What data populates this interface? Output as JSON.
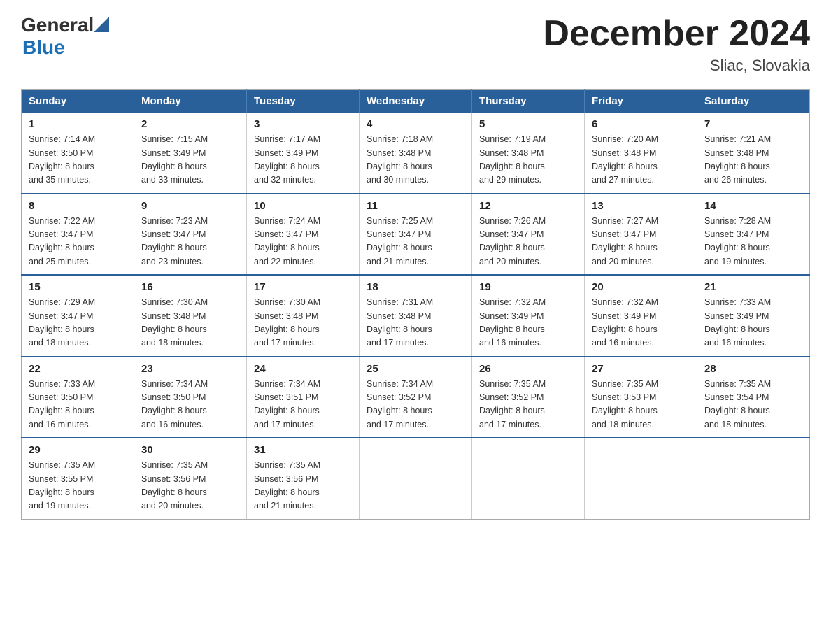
{
  "header": {
    "logo_general": "General",
    "logo_blue": "Blue",
    "title": "December 2024",
    "location": "Sliac, Slovakia"
  },
  "days_of_week": [
    "Sunday",
    "Monday",
    "Tuesday",
    "Wednesday",
    "Thursday",
    "Friday",
    "Saturday"
  ],
  "weeks": [
    [
      {
        "day": "1",
        "sunrise": "7:14 AM",
        "sunset": "3:50 PM",
        "daylight": "8 hours and 35 minutes."
      },
      {
        "day": "2",
        "sunrise": "7:15 AM",
        "sunset": "3:49 PM",
        "daylight": "8 hours and 33 minutes."
      },
      {
        "day": "3",
        "sunrise": "7:17 AM",
        "sunset": "3:49 PM",
        "daylight": "8 hours and 32 minutes."
      },
      {
        "day": "4",
        "sunrise": "7:18 AM",
        "sunset": "3:48 PM",
        "daylight": "8 hours and 30 minutes."
      },
      {
        "day": "5",
        "sunrise": "7:19 AM",
        "sunset": "3:48 PM",
        "daylight": "8 hours and 29 minutes."
      },
      {
        "day": "6",
        "sunrise": "7:20 AM",
        "sunset": "3:48 PM",
        "daylight": "8 hours and 27 minutes."
      },
      {
        "day": "7",
        "sunrise": "7:21 AM",
        "sunset": "3:48 PM",
        "daylight": "8 hours and 26 minutes."
      }
    ],
    [
      {
        "day": "8",
        "sunrise": "7:22 AM",
        "sunset": "3:47 PM",
        "daylight": "8 hours and 25 minutes."
      },
      {
        "day": "9",
        "sunrise": "7:23 AM",
        "sunset": "3:47 PM",
        "daylight": "8 hours and 23 minutes."
      },
      {
        "day": "10",
        "sunrise": "7:24 AM",
        "sunset": "3:47 PM",
        "daylight": "8 hours and 22 minutes."
      },
      {
        "day": "11",
        "sunrise": "7:25 AM",
        "sunset": "3:47 PM",
        "daylight": "8 hours and 21 minutes."
      },
      {
        "day": "12",
        "sunrise": "7:26 AM",
        "sunset": "3:47 PM",
        "daylight": "8 hours and 20 minutes."
      },
      {
        "day": "13",
        "sunrise": "7:27 AM",
        "sunset": "3:47 PM",
        "daylight": "8 hours and 20 minutes."
      },
      {
        "day": "14",
        "sunrise": "7:28 AM",
        "sunset": "3:47 PM",
        "daylight": "8 hours and 19 minutes."
      }
    ],
    [
      {
        "day": "15",
        "sunrise": "7:29 AM",
        "sunset": "3:47 PM",
        "daylight": "8 hours and 18 minutes."
      },
      {
        "day": "16",
        "sunrise": "7:30 AM",
        "sunset": "3:48 PM",
        "daylight": "8 hours and 18 minutes."
      },
      {
        "day": "17",
        "sunrise": "7:30 AM",
        "sunset": "3:48 PM",
        "daylight": "8 hours and 17 minutes."
      },
      {
        "day": "18",
        "sunrise": "7:31 AM",
        "sunset": "3:48 PM",
        "daylight": "8 hours and 17 minutes."
      },
      {
        "day": "19",
        "sunrise": "7:32 AM",
        "sunset": "3:49 PM",
        "daylight": "8 hours and 16 minutes."
      },
      {
        "day": "20",
        "sunrise": "7:32 AM",
        "sunset": "3:49 PM",
        "daylight": "8 hours and 16 minutes."
      },
      {
        "day": "21",
        "sunrise": "7:33 AM",
        "sunset": "3:49 PM",
        "daylight": "8 hours and 16 minutes."
      }
    ],
    [
      {
        "day": "22",
        "sunrise": "7:33 AM",
        "sunset": "3:50 PM",
        "daylight": "8 hours and 16 minutes."
      },
      {
        "day": "23",
        "sunrise": "7:34 AM",
        "sunset": "3:50 PM",
        "daylight": "8 hours and 16 minutes."
      },
      {
        "day": "24",
        "sunrise": "7:34 AM",
        "sunset": "3:51 PM",
        "daylight": "8 hours and 17 minutes."
      },
      {
        "day": "25",
        "sunrise": "7:34 AM",
        "sunset": "3:52 PM",
        "daylight": "8 hours and 17 minutes."
      },
      {
        "day": "26",
        "sunrise": "7:35 AM",
        "sunset": "3:52 PM",
        "daylight": "8 hours and 17 minutes."
      },
      {
        "day": "27",
        "sunrise": "7:35 AM",
        "sunset": "3:53 PM",
        "daylight": "8 hours and 18 minutes."
      },
      {
        "day": "28",
        "sunrise": "7:35 AM",
        "sunset": "3:54 PM",
        "daylight": "8 hours and 18 minutes."
      }
    ],
    [
      {
        "day": "29",
        "sunrise": "7:35 AM",
        "sunset": "3:55 PM",
        "daylight": "8 hours and 19 minutes."
      },
      {
        "day": "30",
        "sunrise": "7:35 AM",
        "sunset": "3:56 PM",
        "daylight": "8 hours and 20 minutes."
      },
      {
        "day": "31",
        "sunrise": "7:35 AM",
        "sunset": "3:56 PM",
        "daylight": "8 hours and 21 minutes."
      },
      null,
      null,
      null,
      null
    ]
  ],
  "labels": {
    "sunrise": "Sunrise:",
    "sunset": "Sunset:",
    "daylight": "Daylight:"
  }
}
